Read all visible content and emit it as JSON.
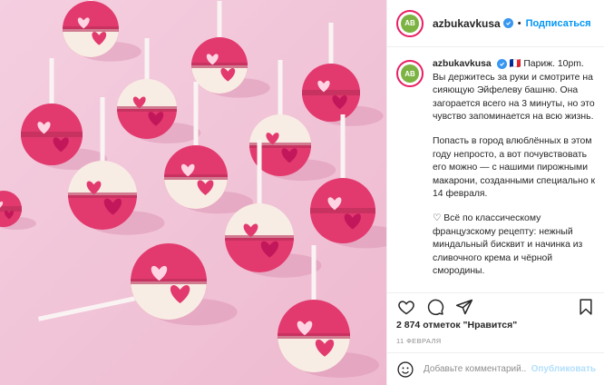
{
  "post": {
    "username": "azbukavkusa",
    "avatar_text": "АВ",
    "follow_separator": "•",
    "follow_label": "Подписаться"
  },
  "caption": {
    "username": "azbukavkusa",
    "flag_emoji": "🇫🇷",
    "lines": [
      "Париж. 10pm.",
      "Вы держитесь за руки и смотрите на сияющую Эйфелеву башню. Она загорается всего на 3 минуты, но это чувство запоминается на всю жизнь.",
      "Попасть в город влюблённых в этом году непросто, а вот почувствовать его можно — с нашими пирожными макарони, созданными специально к 14 февраля.",
      "♡ Всё по классическому французскому рецепту: нежный миндальный бисквит и начинка из сливочного крема и чёрной смородины."
    ]
  },
  "likes": "2 874 отметок \"Нравится\"",
  "date": "11 ФЕВРАЛЯ",
  "comment": {
    "placeholder": "Добавьте комментарий...",
    "post_label": "Опубликовать"
  },
  "icons": [
    "heart-icon",
    "comment-icon",
    "share-icon",
    "bookmark-icon",
    "emoji-icon",
    "verified-icon"
  ],
  "colors": {
    "photo_bg": "#f0c4d8",
    "macaron_pink": "#e23a6e",
    "macaron_light": "#f8ede4",
    "link_blue": "#0095f6"
  }
}
